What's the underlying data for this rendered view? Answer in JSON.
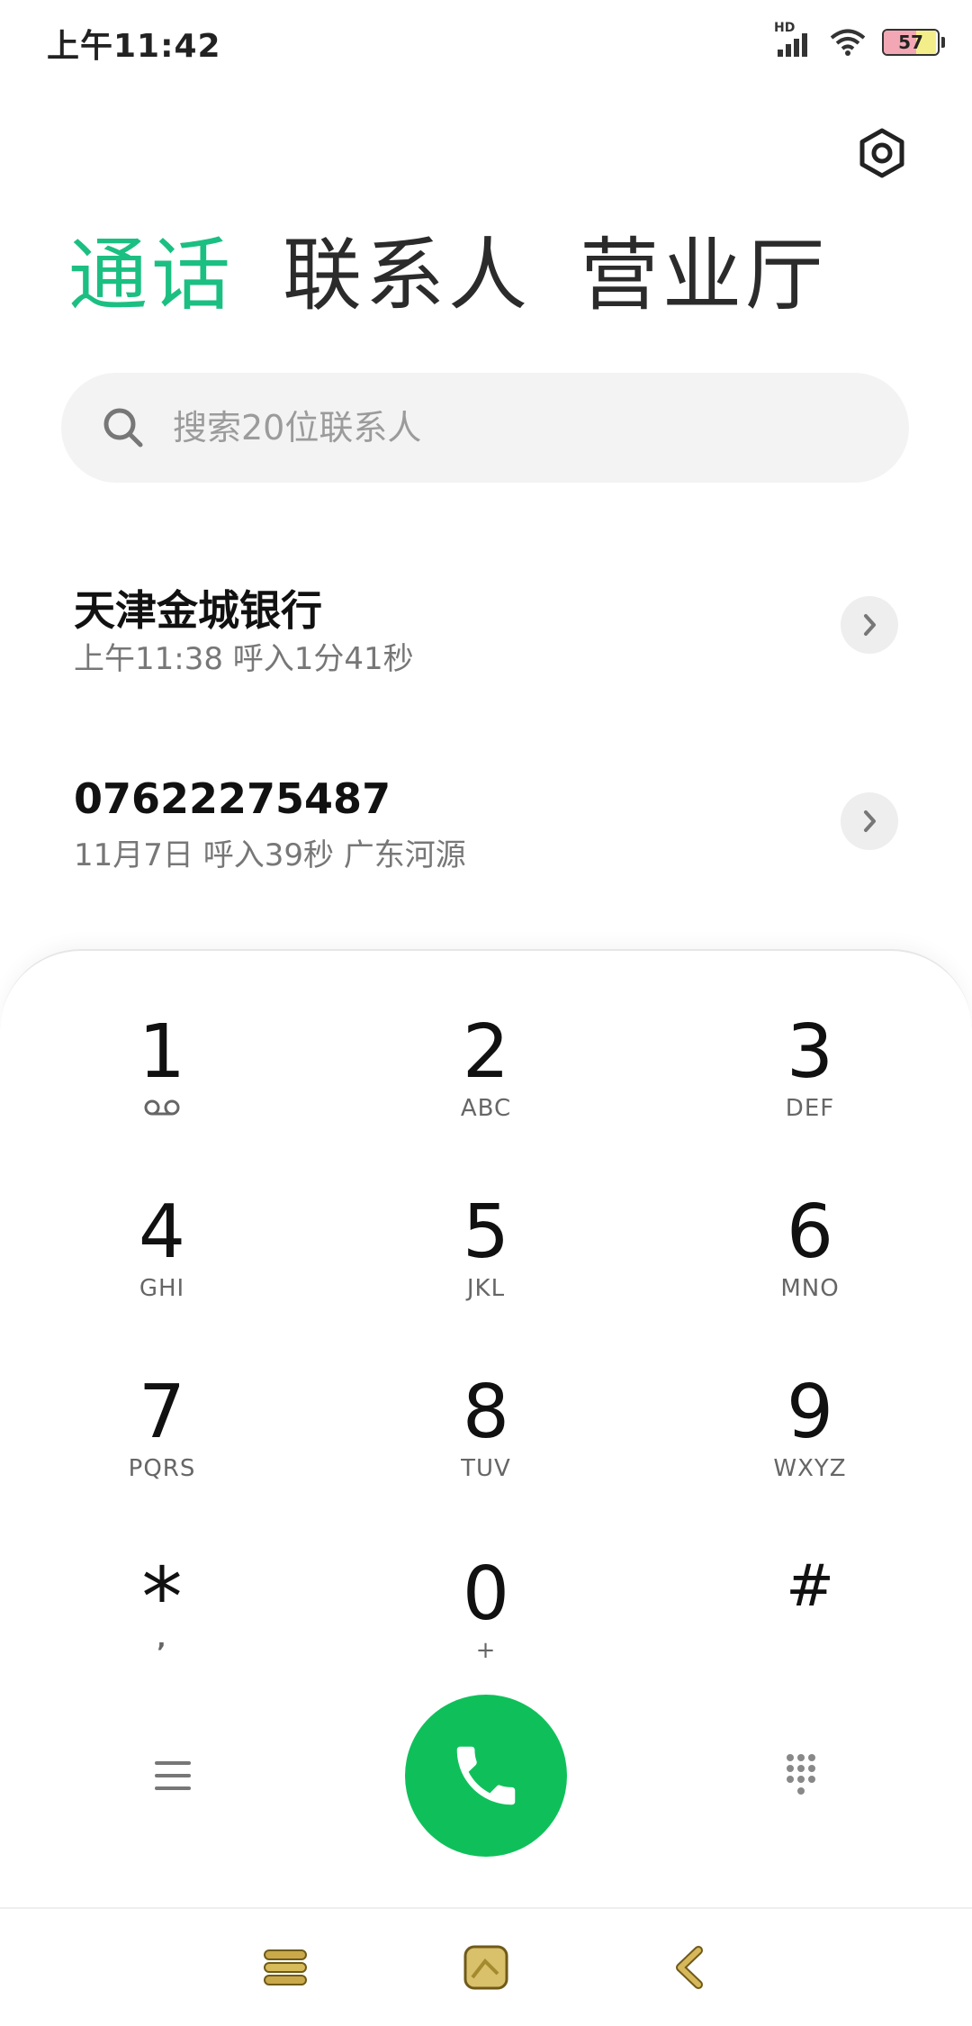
{
  "status_bar": {
    "time": "上午11:42",
    "network_label": "HD",
    "battery_level": "57"
  },
  "header": {
    "settings_icon": "gear-icon"
  },
  "tabs": [
    {
      "label": "通话",
      "active": true
    },
    {
      "label": "联系人",
      "active": false
    },
    {
      "label": "营业厅",
      "active": false
    }
  ],
  "search": {
    "placeholder": "搜索20位联系人"
  },
  "call_log": [
    {
      "name": "天津金城银行",
      "detail": "上午11:38 呼入1分41秒"
    },
    {
      "name": "07622275487",
      "detail": "11月7日 呼入39秒 广东河源"
    }
  ],
  "dialpad": {
    "keys": [
      {
        "digit": "1",
        "letters": ""
      },
      {
        "digit": "2",
        "letters": "ABC"
      },
      {
        "digit": "3",
        "letters": "DEF"
      },
      {
        "digit": "4",
        "letters": "GHI"
      },
      {
        "digit": "5",
        "letters": "JKL"
      },
      {
        "digit": "6",
        "letters": "MNO"
      },
      {
        "digit": "7",
        "letters": "PQRS"
      },
      {
        "digit": "8",
        "letters": "TUV"
      },
      {
        "digit": "9",
        "letters": "WXYZ"
      },
      {
        "digit": "*",
        "letters": ","
      },
      {
        "digit": "0",
        "letters": "+"
      },
      {
        "digit": "#",
        "letters": ""
      }
    ]
  },
  "colors": {
    "accent": "#1bbf82",
    "call_button": "#0fc05a"
  }
}
